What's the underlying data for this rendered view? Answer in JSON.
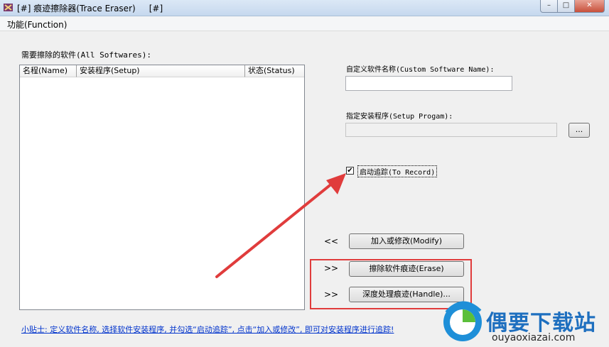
{
  "window": {
    "title": "[#] 痕迹擦除器(Trace Eraser)     [#]",
    "minimize_glyph": "–",
    "maximize_glyph": "□",
    "close_glyph": "✕"
  },
  "menu": {
    "function_label": "功能(Function)"
  },
  "software_list": {
    "label": "需要擦除的软件(All Softwares):",
    "columns": [
      "名程(Name)",
      "安装程序(Setup)",
      "状态(Status)"
    ],
    "rows": []
  },
  "custom_name": {
    "label": "自定义软件名称(Custom Software Name):",
    "value": ""
  },
  "setup_program": {
    "label": "指定安装程序(Setup Progam):",
    "value": "",
    "browse_label": "..."
  },
  "record": {
    "label": "启动追踪(To Record)",
    "checked": true,
    "check_glyph": "✔"
  },
  "actions": {
    "modify": {
      "arrow": "<<",
      "label": "加入或修改(Modify)"
    },
    "erase": {
      "arrow": ">>",
      "label": "擦除软件痕迹(Erase)"
    },
    "handle": {
      "arrow": ">>",
      "label": "深度处理痕迹(Handle)..."
    }
  },
  "tip": "小贴士: 定义软件名称, 选择软件安装程序, 并勾选“启动追踪”, 点击“加入或修改”, 即可对安装程序进行追踪!",
  "watermark": {
    "brand": "偶要下载站",
    "url": "ouyaoxiazai.com"
  },
  "colors": {
    "annotation_red": "#e03c3c",
    "tip_blue": "#0033cc"
  }
}
